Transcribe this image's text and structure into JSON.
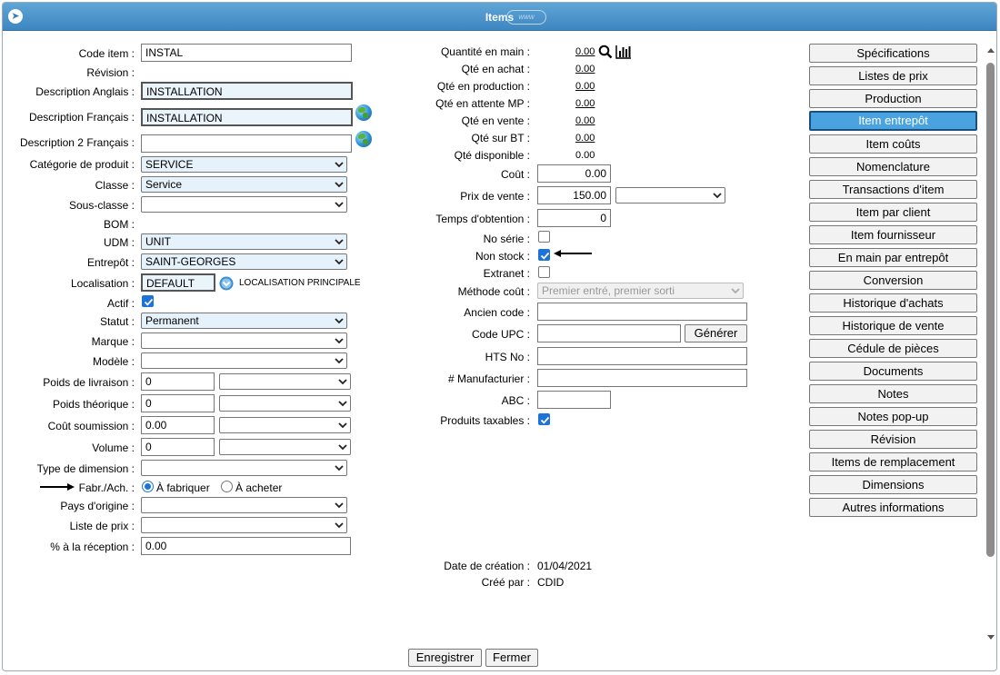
{
  "window": {
    "title": "Items"
  },
  "left": {
    "code_item": {
      "label": "Code item :",
      "value": "INSTAL"
    },
    "revision": {
      "label": "Révision :"
    },
    "desc_en": {
      "label": "Description Anglais :",
      "value": "INSTALLATION"
    },
    "desc_fr": {
      "label": "Description Français :",
      "value": "INSTALLATION"
    },
    "desc2_fr": {
      "label": "Description 2 Français :",
      "value": ""
    },
    "categorie": {
      "label": "Catégorie de produit :",
      "value": "SERVICE"
    },
    "classe": {
      "label": "Classe :",
      "value": "Service"
    },
    "sous_classe": {
      "label": "Sous-classe :",
      "value": ""
    },
    "bom": {
      "label": "BOM :"
    },
    "udm": {
      "label": "UDM :",
      "value": "UNIT"
    },
    "entrepot": {
      "label": "Entrepôt :",
      "value": "SAINT-GEORGES"
    },
    "localisation": {
      "label": "Localisation :",
      "value": "DEFAULT",
      "note": "LOCALISATION PRINCIPALE"
    },
    "actif": {
      "label": "Actif :",
      "checked": true
    },
    "statut": {
      "label": "Statut :",
      "value": "Permanent"
    },
    "marque": {
      "label": "Marque :",
      "value": ""
    },
    "modele": {
      "label": "Modèle :",
      "value": ""
    },
    "poids_livraison": {
      "label": "Poids de livraison :",
      "value": "0",
      "unit": ""
    },
    "poids_theorique": {
      "label": "Poids théorique :",
      "value": "0",
      "unit": ""
    },
    "cout_soumission": {
      "label": "Coût soumission :",
      "value": "0.00",
      "unit": ""
    },
    "volume": {
      "label": "Volume :",
      "value": "0",
      "unit": ""
    },
    "type_dimension": {
      "label": "Type de dimension :",
      "value": ""
    },
    "fabr_ach": {
      "label": "Fabr./Ach. :",
      "option1": "À fabriquer",
      "option2": "À acheter",
      "selected": "À fabriquer"
    },
    "pays_origine": {
      "label": "Pays d'origine :",
      "value": ""
    },
    "liste_prix": {
      "label": "Liste de prix :",
      "value": ""
    },
    "pct_reception": {
      "label": "% à la réception :",
      "value": "0.00"
    }
  },
  "middle": {
    "qte_en_main": {
      "label": "Quantité en main :",
      "value": "0.00"
    },
    "qte_achat": {
      "label": "Qté en achat :",
      "value": "0.00"
    },
    "qte_production": {
      "label": "Qté en production :",
      "value": "0.00"
    },
    "qte_attente_mp": {
      "label": "Qté en attente MP :",
      "value": "0.00"
    },
    "qte_vente": {
      "label": "Qté en vente :",
      "value": "0.00"
    },
    "qte_bt": {
      "label": "Qté sur BT :",
      "value": "0.00"
    },
    "qte_disponible": {
      "label": "Qté disponible :",
      "value": "0.00"
    },
    "cout": {
      "label": "Coût :",
      "value": "0.00"
    },
    "prix_vente": {
      "label": "Prix de vente :",
      "value": "150.00",
      "currency": ""
    },
    "temps_obtention": {
      "label": "Temps d'obtention :",
      "value": "0"
    },
    "no_serie": {
      "label": "No série :",
      "checked": false
    },
    "non_stock": {
      "label": "Non stock :",
      "checked": true
    },
    "extranet": {
      "label": "Extranet :",
      "checked": false
    },
    "methode_cout": {
      "label": "Méthode coût :",
      "value": "Premier entré, premier sorti"
    },
    "ancien_code": {
      "label": "Ancien code :",
      "value": ""
    },
    "code_upc": {
      "label": "Code UPC :",
      "value": "",
      "button": "Générer"
    },
    "hts_no": {
      "label": "HTS No :",
      "value": ""
    },
    "manufacturier": {
      "label": "# Manufacturier :",
      "value": ""
    },
    "abc": {
      "label": "ABC :",
      "value": ""
    },
    "produits_taxables": {
      "label": "Produits taxables :",
      "checked": true
    },
    "date_creation": {
      "label": "Date de création :",
      "value": "01/04/2021"
    },
    "cree_par": {
      "label": "Créé par :",
      "value": "CDID"
    }
  },
  "sidebar": {
    "active": "Item entrepôt",
    "items": [
      "Spécifications",
      "Listes de prix",
      "Production",
      "Item entrepôt",
      "Item coûts",
      "Nomenclature",
      "Transactions d'item",
      "Item par client",
      "Item fournisseur",
      "En main par entrepôt",
      "Conversion",
      "Historique d'achats",
      "Historique de vente",
      "Cédule de pièces",
      "Documents",
      "Notes",
      "Notes pop-up",
      "Révision",
      "Items de remplacement",
      "Dimensions",
      "Autres informations"
    ]
  },
  "footer": {
    "save": "Enregistrer",
    "close": "Fermer"
  },
  "colors": {
    "titlebar": "#3d86c0",
    "active_button": "#4aa3df",
    "checkbox": "#1e73d9"
  }
}
